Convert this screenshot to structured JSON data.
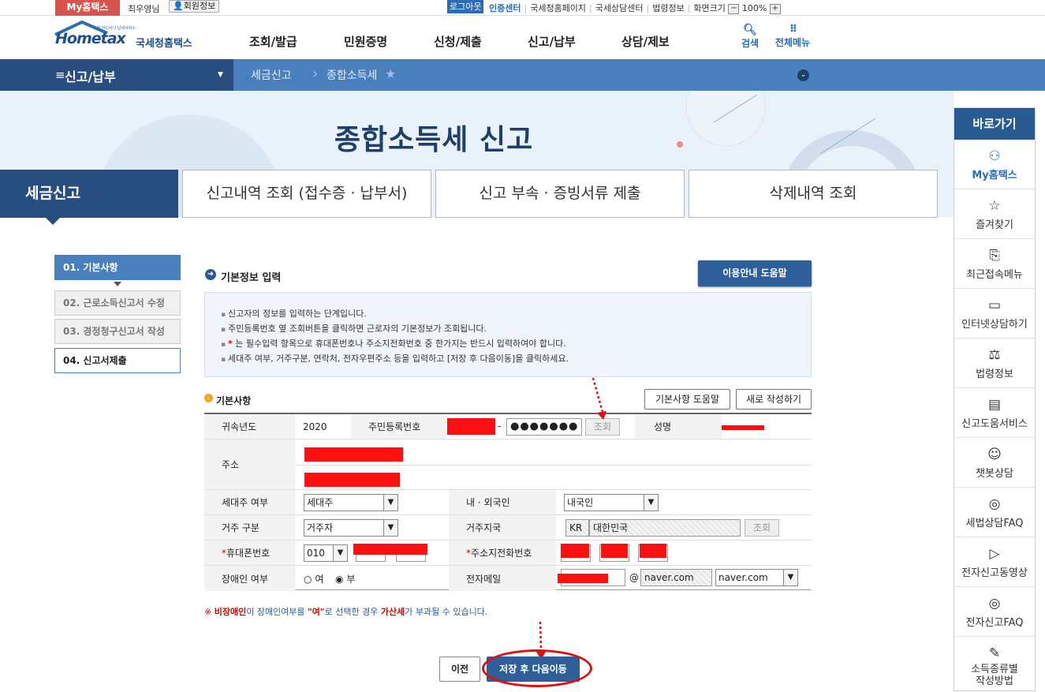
{
  "topbar": {
    "my_hometax": "My홈택스",
    "username": "최우영님",
    "member_info": "회원정보",
    "logout": "로그아웃",
    "cert_center": "인증센터",
    "links": [
      "국세청홈페이지",
      "국세상담센터",
      "법령정보",
      "화면크기"
    ],
    "zoom_minus": "−",
    "zoom": "100%",
    "zoom_plus": "+"
  },
  "logo": {
    "small": "언제 어디서나 납세서비스",
    "brand": "Hometax",
    "name": "국세청홈택스"
  },
  "nav": [
    "조회/발급",
    "민원증명",
    "신청/제출",
    "신고/납부",
    "상담/제보"
  ],
  "header_icons": {
    "search": "검색",
    "all_menu": "전체메뉴"
  },
  "subbar": {
    "menu": "신고/납부",
    "crumbs": [
      "세금신고",
      "종합소득세"
    ]
  },
  "hero": {
    "title": "종합소득세 신고"
  },
  "tabs": {
    "active": "세금신고",
    "items": [
      "신고내역 조회 (접수증 · 납부서)",
      "신고 부속 · 증빙서류 제출",
      "삭제내역 조회"
    ]
  },
  "quick": {
    "title": "바로가기",
    "items": [
      {
        "label": "My홈택스",
        "icon": "person-icon"
      },
      {
        "label": "즐겨찾기",
        "icon": "star-icon"
      },
      {
        "label": "최근접속메뉴",
        "icon": "recent-icon"
      },
      {
        "label": "인터넷상담하기",
        "icon": "monitor-icon"
      },
      {
        "label": "법령정보",
        "icon": "gavel-icon"
      },
      {
        "label": "신고도움서비스",
        "icon": "book-icon"
      },
      {
        "label": "챗봇상담",
        "icon": "chatbot-icon"
      },
      {
        "label": "세법상담FAQ",
        "icon": "chat-icon"
      },
      {
        "label": "전자신고동영상",
        "icon": "play-icon"
      },
      {
        "label": "전자신고FAQ",
        "icon": "chat-icon"
      },
      {
        "label": "소득종류별 작성방법",
        "icon": "edit-icon"
      }
    ]
  },
  "steps": [
    "01. 기본사항",
    "02. 근로소득신고서 수정",
    "03. 경정청구신고서 작성",
    "04. 신고서제출"
  ],
  "section": {
    "title": "기본정보 입력",
    "help": "이용안내 도움말"
  },
  "info_lines": [
    "신고자의 정보를 입력하는 단계입니다.",
    "주민등록번호 옆 조회버튼을 클릭하면 근로자의 기본정보가 조회됩니다.",
    "는 필수입력 항목으로 휴대폰번호나 주소지전화번호 중 한가지는 반드시 입력하여야 합니다.",
    "세대주 여부, 거주구분, 연락처, 전자우편주소 등을 입력하고 [저장 후 다음이동]을 클릭하세요."
  ],
  "info_star": "*",
  "basic": {
    "title": "기본사항",
    "help_btn": "기본사항 도움말",
    "new_btn": "새로 작성하기"
  },
  "form": {
    "year_label": "귀속년도",
    "year": "2020",
    "rrn_label": "주민등록번호",
    "rrn_dash": "-",
    "rrn_back": "●●●●●●●",
    "lookup": "조회",
    "name_label": "성명",
    "addr_label": "주소",
    "head_label": "세대주 여부",
    "head_value": "세대주",
    "nation_label": "내 · 외국인",
    "nation_value": "내국인",
    "resident_label": "거주 구분",
    "resident_value": "거주자",
    "country_label": "거주지국",
    "country_code": "KR",
    "country_name": "대한민국",
    "country_lookup": "조회",
    "mobile_label": "휴대폰번호",
    "mobile_prefix": "010",
    "phone_label": "주소지전화번호",
    "req_star": "*",
    "disabled_label": "장애인 여부",
    "radio_yes": "여",
    "radio_no": "부",
    "email_label": "전자메일",
    "email_at": "@",
    "email_domain": "naver.com",
    "email_select": "naver.com"
  },
  "notice": {
    "mark": "※",
    "b1": "비장애인",
    "t1": "이 장애인여부를 ",
    "q": "\"여\"",
    "t2": "로 선택한 경우 ",
    "b2": "가산세",
    "t3": "가 부과될 수 있습니다."
  },
  "buttons": {
    "prev": "이전",
    "next": "저장 후 다음이동"
  }
}
